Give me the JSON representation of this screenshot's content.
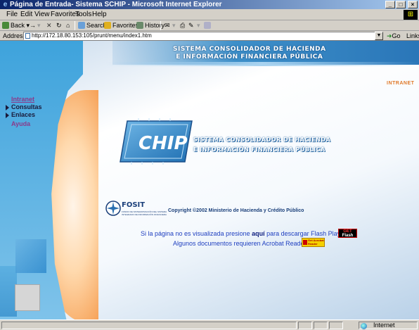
{
  "window": {
    "title": "Página de Entrada- Sistema SCHIP - Microsoft Internet Explorer",
    "controls": {
      "minimize": "_",
      "maximize": "□",
      "close": "×"
    }
  },
  "menu": [
    "File",
    "Edit",
    "View",
    "Favorites",
    "Tools",
    "Help"
  ],
  "toolbar": {
    "back": "Back",
    "forward": "→",
    "stop": "✕",
    "refresh": "↻",
    "home": "⌂",
    "search": "Search",
    "favorites": "Favorites",
    "history": "History",
    "mail": "✉",
    "print": "⎙",
    "edit": "✎"
  },
  "address": {
    "label": "Address",
    "url": "http://172.18.80.153:105/prunt/menu/index1.htm",
    "go": "Go",
    "links": "Links"
  },
  "page": {
    "header_title_line1": "SISTEMA CONSOLIDADOR DE HACIENDA",
    "header_title_line2": "E INFORMACIÓN FINANCIERA PÚBLICA",
    "intranet_tag": "INTRANET",
    "nav": [
      {
        "label": "Intranet",
        "style": "link"
      },
      {
        "label": "Consultas",
        "style": "arrow"
      },
      {
        "label": "Enlaces",
        "style": "arrow"
      },
      {
        "label": "Ayuda",
        "style": "purple"
      }
    ],
    "chip_logo": "CHIP",
    "chip_text_line1": "SISTEMA CONSOLIDADOR DE HACIENDA",
    "chip_text_line2": "E INFORMACIÓN FINANCIERA PÚBLICA",
    "fosit_name": "FOSIT",
    "fosit_sub": "FONDO DE SISTEMATIZACIÓN DEL SISTEMA INTEGRADO DE INFORMACIÓN FINANCIERA",
    "copyright": "Copyright ©2002 Ministerio de Hacienda y Crédito Público",
    "flash_pre": "Si la página no es visualizada presione ",
    "flash_link": "aquí",
    "flash_post": " para descargar Flash Player",
    "flash_badge_line1": "GET",
    "flash_badge_line2": "Flash",
    "acrobat_text": "Algunos documentos requieren Acrobat Reader",
    "acrobat_badge": "Get Acrobat Reader"
  },
  "status": {
    "zone": "Internet"
  },
  "colors": {
    "titlebar": "#0a246a",
    "accent_blue": "#2a76b8",
    "accent_orange": "#f59a4b",
    "link": "#2040c0"
  }
}
